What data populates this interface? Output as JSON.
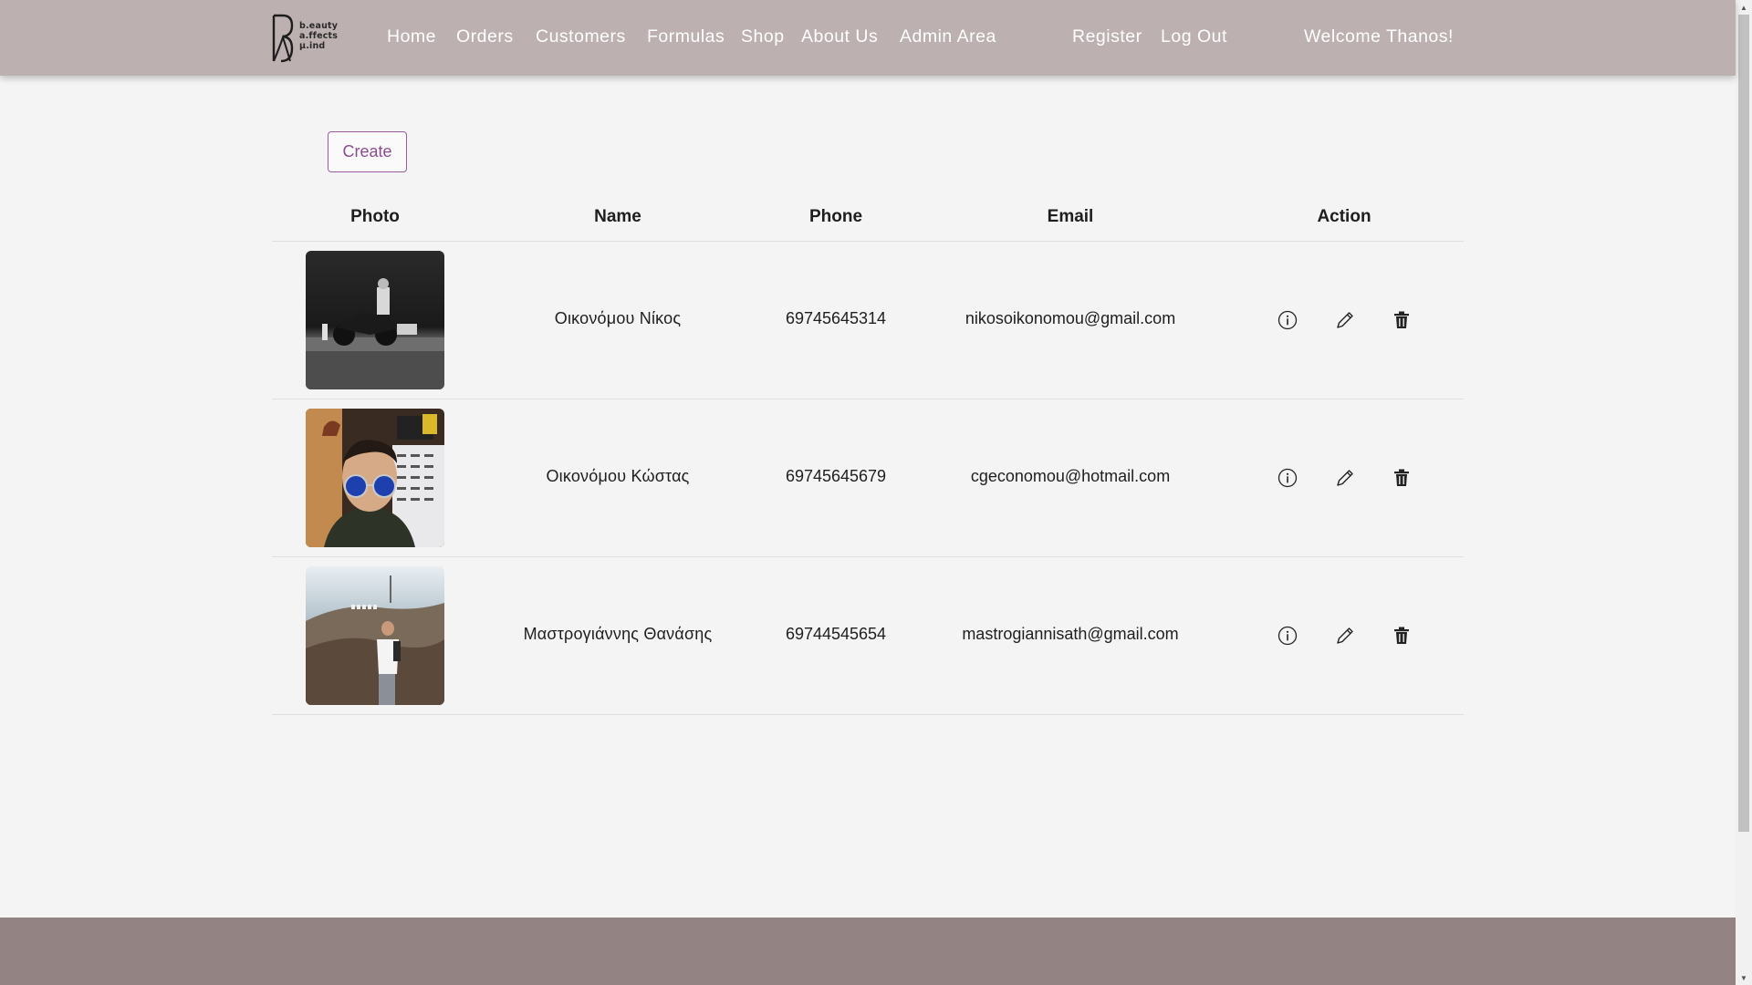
{
  "brand": {
    "logo_lines": [
      "b.eauty",
      "a.ffects",
      "µ.ind"
    ]
  },
  "nav": {
    "home": "Home",
    "orders": "Orders",
    "customers": "Customers",
    "formulas": "Formulas",
    "shop": "Shop",
    "about": "About Us",
    "admin": "Admin Area",
    "register": "Register",
    "logout": "Log Out",
    "welcome": "Welcome Thanos!"
  },
  "toolbar": {
    "create_label": "Create"
  },
  "table": {
    "headers": [
      "Photo",
      "Name",
      "Phone",
      "Email",
      "Action"
    ],
    "rows": [
      {
        "name": "Οικονόμου Νίκος",
        "phone": "69745645314",
        "email": "nikosoikonomou@gmail.com"
      },
      {
        "name": "Οικονόμου Κώστας",
        "phone": "69745645679",
        "email": "cgeconomou@hotmail.com"
      },
      {
        "name": "Μαστρογιάννης Θανάσης",
        "phone": "69744545654",
        "email": "mastrogiannisath@gmail.com"
      }
    ]
  },
  "icons": {
    "details": "info-icon",
    "edit": "pencil-icon",
    "delete": "trash-icon"
  },
  "colors": {
    "navbar": "#bdb0b0",
    "footer": "#948383",
    "accent": "#8b4c8f",
    "background": "#f4f4f4"
  }
}
